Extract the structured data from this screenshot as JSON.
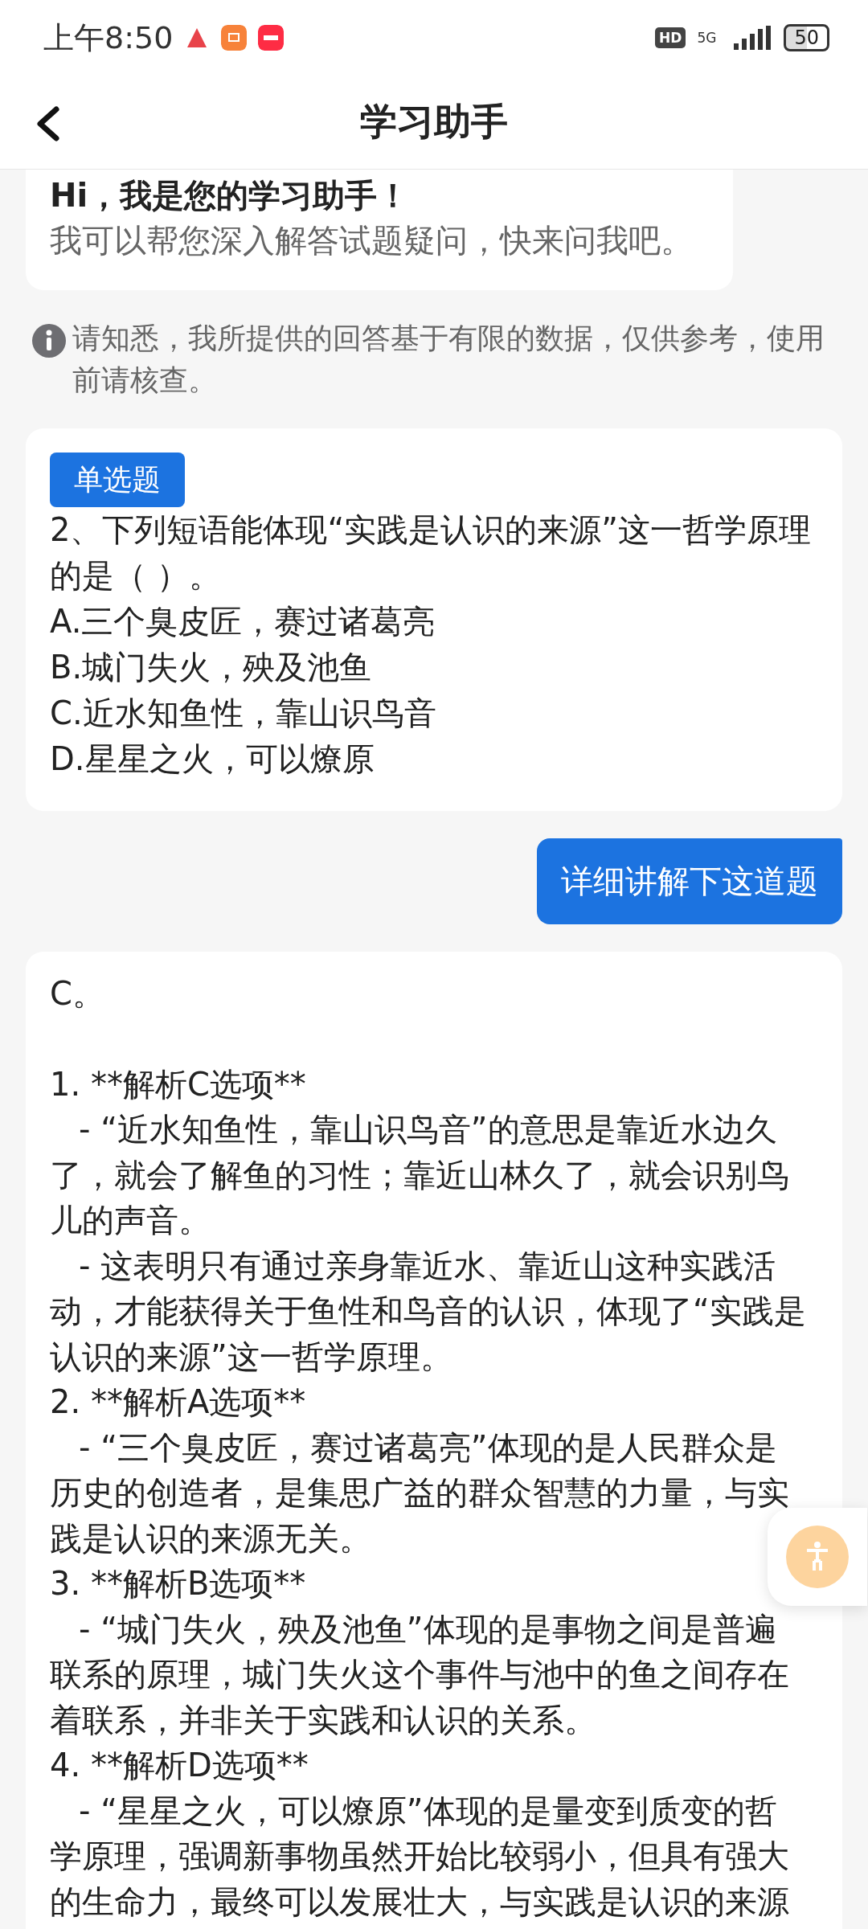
{
  "status_bar": {
    "time": "上午8:50",
    "hd": "HD",
    "network": "5G",
    "battery": "50"
  },
  "header": {
    "title": "学习助手"
  },
  "greeting": {
    "title": "Hi，我是您的学习助手！",
    "subtitle": "我可以帮您深入解答试题疑问，快来问我吧。"
  },
  "notice": "请知悉，我所提供的回答基于有限的数据，仅供参考，使用前请核查。",
  "question": {
    "tag": "单选题",
    "text": "2、下列短语能体现“实践是认识的来源”这一哲学原理的是（    ）。",
    "options": [
      "A.三个臭皮匠，赛过诸葛亮",
      "B.城门失火，殃及池鱼",
      "C.近水知鱼性，靠山识鸟音",
      "D.星星之火，可以燎原"
    ]
  },
  "user_message": "详细讲解下这道题",
  "answer": {
    "lead": "C。",
    "points": [
      {
        "heading": "1. **解析C选项**",
        "bullets": [
          "- “近水知鱼性，靠山识鸟音”的意思是靠近水边久了，就会了解鱼的习性；靠近山林久了，就会识别鸟儿的声音。",
          "- 这表明只有通过亲身靠近水、靠近山这种实践活动，才能获得关于鱼性和鸟音的认识，体现了“实践是认识的来源”这一哲学原理。"
        ]
      },
      {
        "heading": "2. **解析A选项**",
        "bullets": [
          "- “三个臭皮匠，赛过诸葛亮”体现的是人民群众是历史的创造者，是集思广益的群众智慧的力量，与实践是认识的来源无关。"
        ]
      },
      {
        "heading": "3. **解析B选项**",
        "bullets": [
          "- “城门失火，殃及池鱼”体现的是事物之间是普遍联系的原理，城门失火这个事件与池中的鱼之间存在着联系，并非关于实践和认识的关系。"
        ]
      },
      {
        "heading": "4. **解析D选项**",
        "bullets": [
          "- “星星之火，可以燎原”体现的是量变到质变的哲学原理，强调新事物虽然开始比较弱小，但具有强大的生命力，最终可以发展壮大，与实践是认识的来源"
        ]
      }
    ]
  }
}
